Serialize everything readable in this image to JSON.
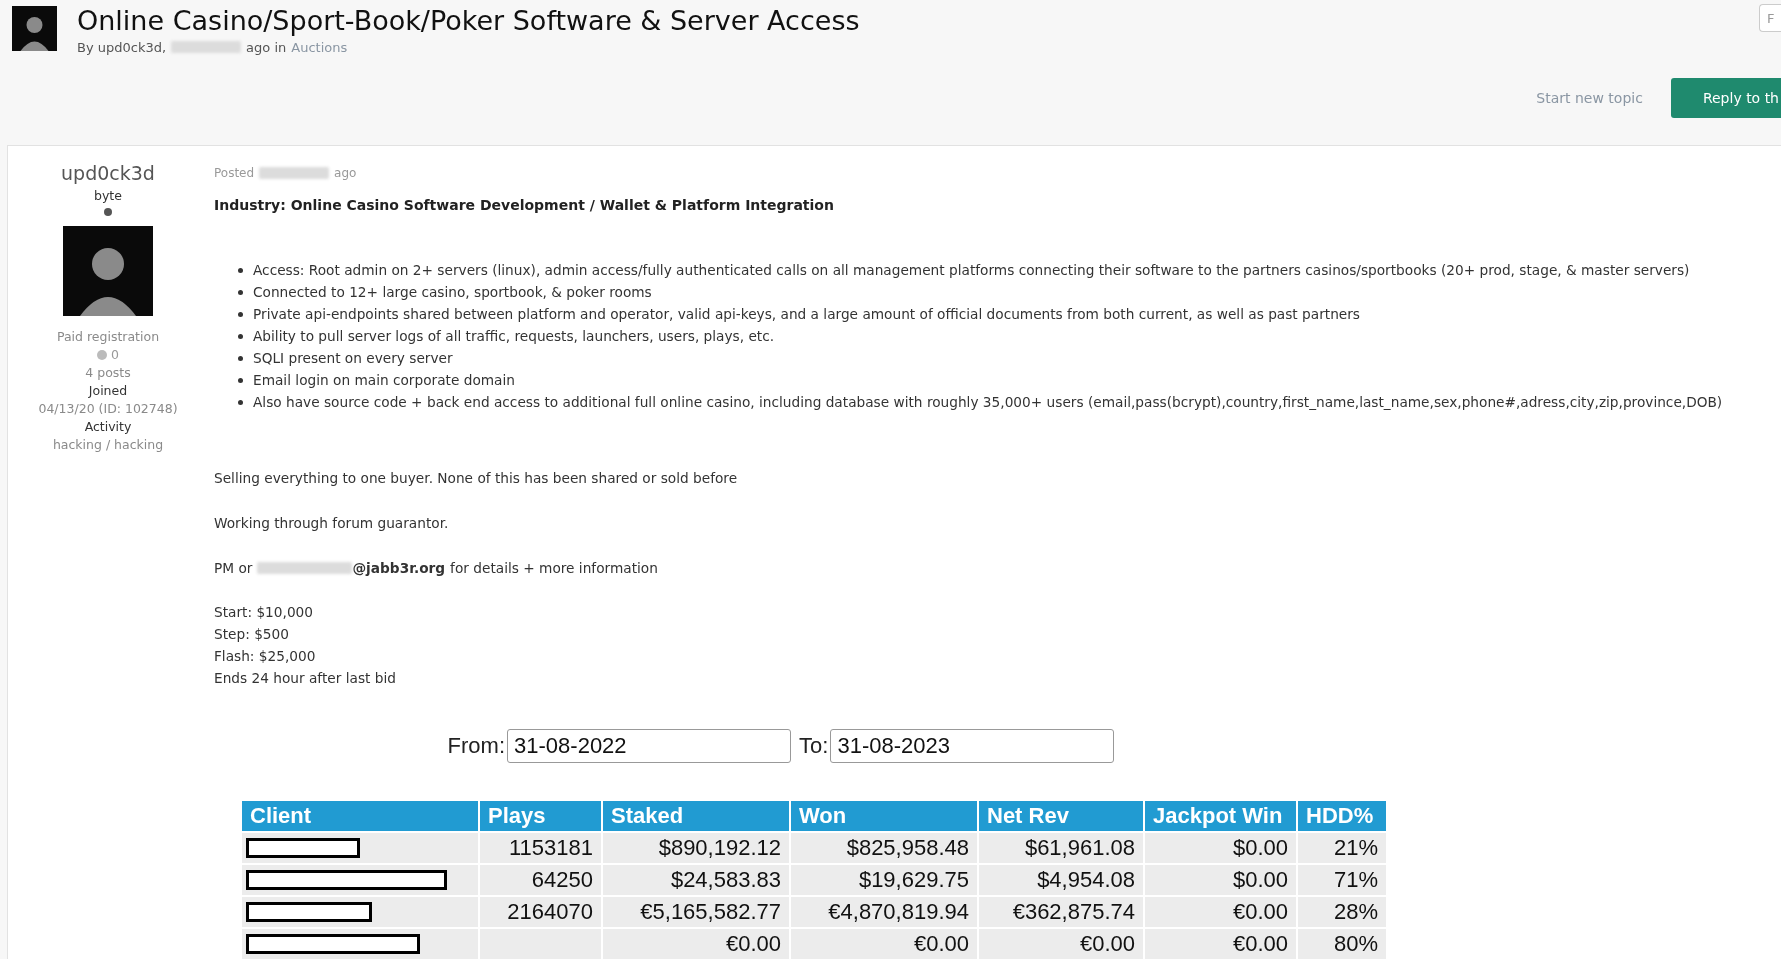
{
  "topic": {
    "title": "Online Casino/Sport-Book/Poker Software & Server Access",
    "byline_prefix": "By upd0ck3d,",
    "byline_ago": "ago in",
    "forum": "Auctions"
  },
  "actions": {
    "corner_button": "F",
    "start_new": "Start new topic",
    "reply": "Reply to th"
  },
  "author": {
    "name": "upd0ck3d",
    "rank": "byte",
    "group": "Paid registration",
    "reputation": "0",
    "posts": "4 posts",
    "joined_label": "Joined",
    "joined": "04/13/20 (ID: 102748)",
    "activity_label": "Activity",
    "activity": "hacking / hacking"
  },
  "post": {
    "posted_prefix": "Posted",
    "posted_suffix": "ago",
    "industry": "Industry: Online Casino Software Development / Wallet & Platform Integration",
    "bullets": [
      "Access: Root admin on 2+ servers (linux), admin access/fully authenticated calls on all management platforms connecting their software to the partners casinos/sportbooks (20+ prod, stage, & master servers)",
      "Connected to 12+ large casino, sportbook, & poker rooms",
      "Private api-endpoints shared between platform and operator, valid api-keys, and a large amount of official documents from both current, as well as past partners",
      "Ability to pull server logs of all traffic, requests, launchers, users, plays, etc.",
      "SQLI  present on every server",
      "Email login on main corporate domain",
      "Also have source code + back end access to additional full online casino, including database with roughly 35,000+ users (email,pass(bcrypt),country,first_name,last_name,sex,phone#,adress,city,zip,province,DOB)"
    ],
    "paragraphs": [
      "Selling everything to one buyer. None of this has been shared or sold before",
      "Working through forum guarantor."
    ],
    "contact_prefix": "PM or",
    "contact_domain": "@jabb3r.org",
    "contact_suffix": "for details + more information",
    "terms": [
      "Start: $10,000",
      "Step: $500",
      "Flash: $25,000",
      "Ends 24 hour after last bid"
    ]
  },
  "report": {
    "from_label": "From:",
    "from_value": "31-08-2022",
    "to_label": "To:",
    "to_value": "31-08-2023",
    "columns": [
      "Client",
      "Plays",
      "Staked",
      "Won",
      "Net Rev",
      "Jackpot Win",
      "HDD%"
    ],
    "rows": [
      {
        "plays": "1153181",
        "staked": "$890,192.12",
        "won": "$825,958.48",
        "net_rev": "$61,961.08",
        "jackpot_win": "$0.00",
        "hdd": "21%"
      },
      {
        "plays": "64250",
        "staked": "$24,583.83",
        "won": "$19,629.75",
        "net_rev": "$4,954.08",
        "jackpot_win": "$0.00",
        "hdd": "71%"
      },
      {
        "plays": "2164070",
        "staked": "€5,165,582.77",
        "won": "€4,870,819.94",
        "net_rev": "€362,875.74",
        "jackpot_win": "€0.00",
        "hdd": "28%"
      },
      {
        "staked": "€0.00",
        "won": "€0.00",
        "net_rev": "€0.00",
        "jackpot_win": "€0.00",
        "hdd": "80%"
      }
    ]
  }
}
